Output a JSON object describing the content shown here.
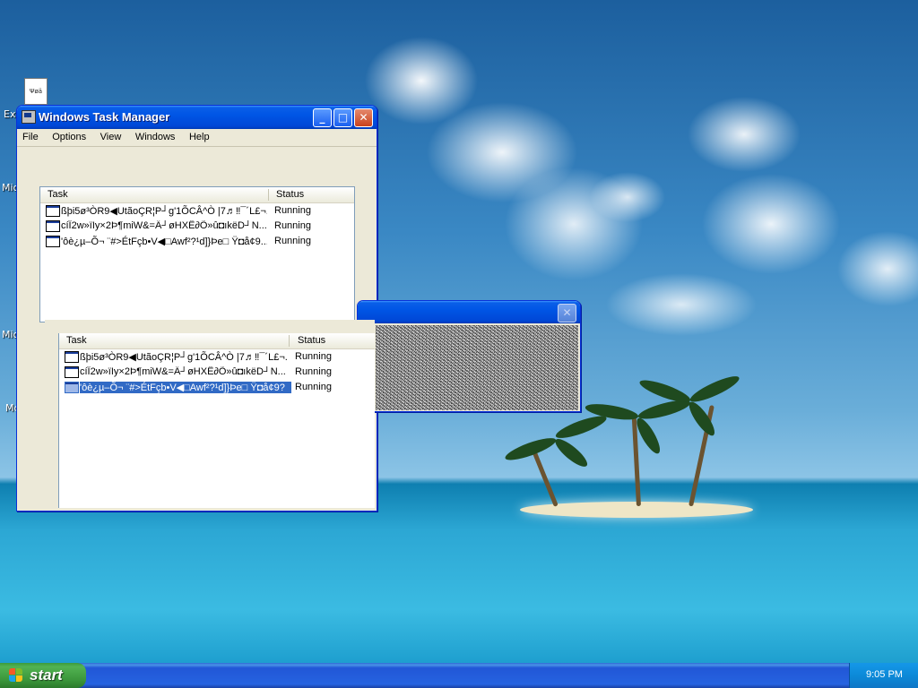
{
  "desktop": {
    "icon_label": "Ψøä",
    "side_fragments": [
      "Ex",
      "Mic",
      "Mic",
      "Mc"
    ]
  },
  "task_manager": {
    "title": "Windows Task Manager",
    "menu": [
      "File",
      "Options",
      "View",
      "Windows",
      "Help"
    ],
    "columns": {
      "task": "Task",
      "status": "Status"
    },
    "tasks": [
      {
        "name": "ßþi5ø³ÒR9◀UtãoÇR¦P┘g'1ÕCÂ^Ò |7♬‼¯´L£¬...",
        "status": "Running"
      },
      {
        "name": "cíÎ2w»ïIy×2Þ¶miW&=Ä┘øHXÊ∂Õ»û◘ıkëD┘N...",
        "status": "Running"
      },
      {
        "name": "'ôè¿µ–Õ¬ ¨#>ÉtFçb•V◀□Awf²?¹d]}Þe□ Ÿ◘å¢9...",
        "status": "Running"
      }
    ]
  },
  "ghost_window": {
    "columns": {
      "task": "Task",
      "status": "Status"
    },
    "tasks": [
      {
        "name": "ßþi5ø³ÒR9◀UtãoÇR¦P┘g'1ÕCÂ^Ò |7♬‼¯´L£¬...",
        "status": "Running"
      },
      {
        "name": "cíÎ2w»ïIy×2Þ¶miW&=Ä┘øHXÊ∂Õ»û◘ıkëD┘N...",
        "status": "Running"
      },
      {
        "name": "'ôè¿µ–Õ¬ ¨#>ÉtFçb•V◀□Awf²?¹d]}Þe□ Ÿ◘å¢9?",
        "status": "Running",
        "selected": true
      }
    ]
  },
  "taskbar": {
    "start_label": "start",
    "clock": "9:05 PM"
  },
  "colors": {
    "title_blue": "#0055e5",
    "selection": "#316ac5",
    "start_green": "#3a953a"
  }
}
